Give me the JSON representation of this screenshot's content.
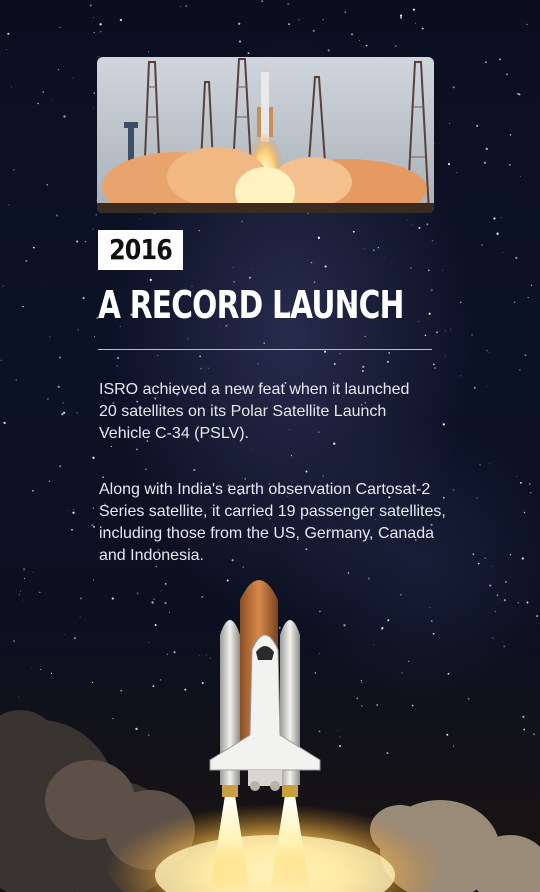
{
  "year": "2016",
  "title": "A RECORD LAUNCH",
  "paragraphs": [
    [
      "ISRO achieved a new feat when it launched",
      "20 satellites on its Polar Satellite Launch",
      "Vehicle C-34 (PSLV)."
    ],
    [
      "Along with India's earth observation Cartosat-2",
      "Series satellite, it carried 19 passenger satellites,",
      "including those from the US, Germany, Canada",
      "and Indonesia."
    ]
  ],
  "colors": {
    "background": "#0a0f20",
    "text": "#ffffff",
    "year_box": "#ffffff"
  },
  "images": {
    "photo": "rocket-launch-photo",
    "illustration": "space-shuttle-liftoff"
  }
}
